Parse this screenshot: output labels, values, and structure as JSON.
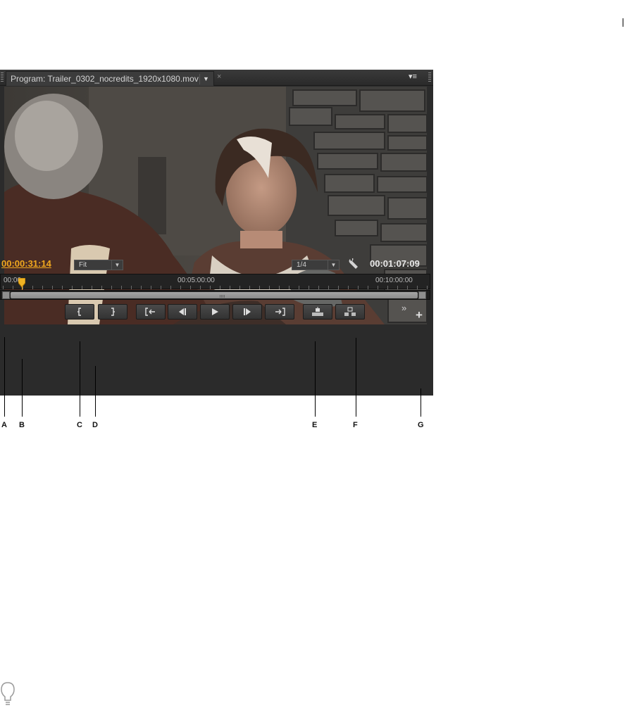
{
  "panel": {
    "tab_title": "Program: Trailer_0302_nocredits_1920x1080.mov",
    "tab_dropdown_icon": "▼",
    "tab_close_icon": "×",
    "panel_menu_icon": "▾≡"
  },
  "monitor": {
    "playhead_timecode": "00:00:31:14",
    "zoom_level": "Fit",
    "playback_resolution": "1/4",
    "duration_timecode": "00:01:07:09",
    "select_arrow": "▼"
  },
  "ruler": {
    "labels": [
      "00:00",
      "00:05:00:00",
      "00:10:00:00"
    ]
  },
  "transport": {
    "buttons": [
      {
        "name": "mark-in",
        "icon": "mark-in-icon"
      },
      {
        "name": "mark-out",
        "icon": "mark-out-icon"
      },
      {
        "name": "go-to-in",
        "icon": "go-to-in-icon"
      },
      {
        "name": "step-back",
        "icon": "step-back-icon"
      },
      {
        "name": "play",
        "icon": "play-icon"
      },
      {
        "name": "step-forward",
        "icon": "step-forward-icon"
      },
      {
        "name": "go-to-out",
        "icon": "go-to-out-icon"
      },
      {
        "name": "lift",
        "icon": "lift-icon"
      },
      {
        "name": "extract",
        "icon": "extract-icon"
      }
    ],
    "more_icon": "»",
    "add_icon": "+"
  },
  "callouts": [
    "A",
    "B",
    "C",
    "D",
    "E",
    "F",
    "G"
  ],
  "colors": {
    "accent_timecode": "#f0a81e",
    "panel_bg": "#2b2b2b"
  }
}
